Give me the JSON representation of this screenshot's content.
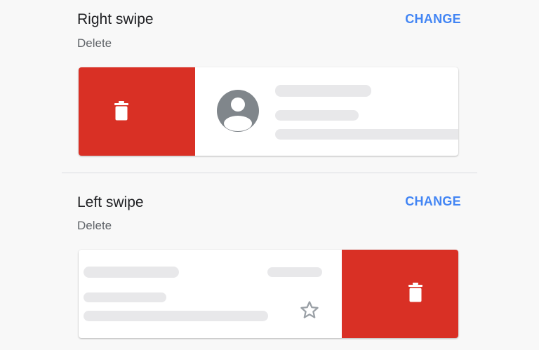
{
  "right_swipe": {
    "title": "Right swipe",
    "action": "Delete",
    "change_label": "CHANGE"
  },
  "left_swipe": {
    "title": "Left swipe",
    "action": "Delete",
    "change_label": "CHANGE"
  },
  "icons": {
    "delete": "trash-icon",
    "avatar": "account-circle-icon",
    "star": "star-outline-icon"
  },
  "colors": {
    "accent": "#4285f4",
    "delete_background": "#d93025",
    "placeholder": "#e8e8ea",
    "avatar": "#80868b",
    "star": "#9aa0a6"
  }
}
